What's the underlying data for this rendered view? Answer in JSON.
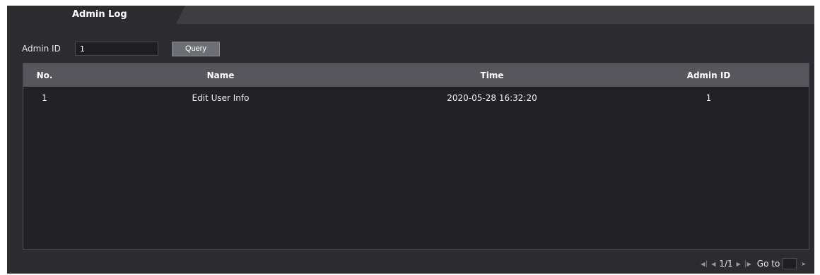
{
  "tab": {
    "label": "Admin Log"
  },
  "query": {
    "admin_id_label": "Admin ID",
    "admin_id_value": "1",
    "query_button": "Query"
  },
  "table": {
    "headers": {
      "no": "No.",
      "name": "Name",
      "time": "Time",
      "admin_id": "Admin ID"
    },
    "rows": [
      {
        "no": "1",
        "name": "Edit User Info",
        "time": "2020-05-28 16:32:20",
        "admin_id": "1"
      }
    ]
  },
  "pager": {
    "page_text": "1/1",
    "goto_label": "Go to",
    "icons": [
      "first-page-icon",
      "prev-page-icon",
      "next-page-icon",
      "last-page-icon",
      "go-icon"
    ]
  },
  "colors": {
    "background": "#2c2c30",
    "tab_active": "#2c2c30",
    "table_header": "#56565c",
    "table_body": "#222226"
  }
}
